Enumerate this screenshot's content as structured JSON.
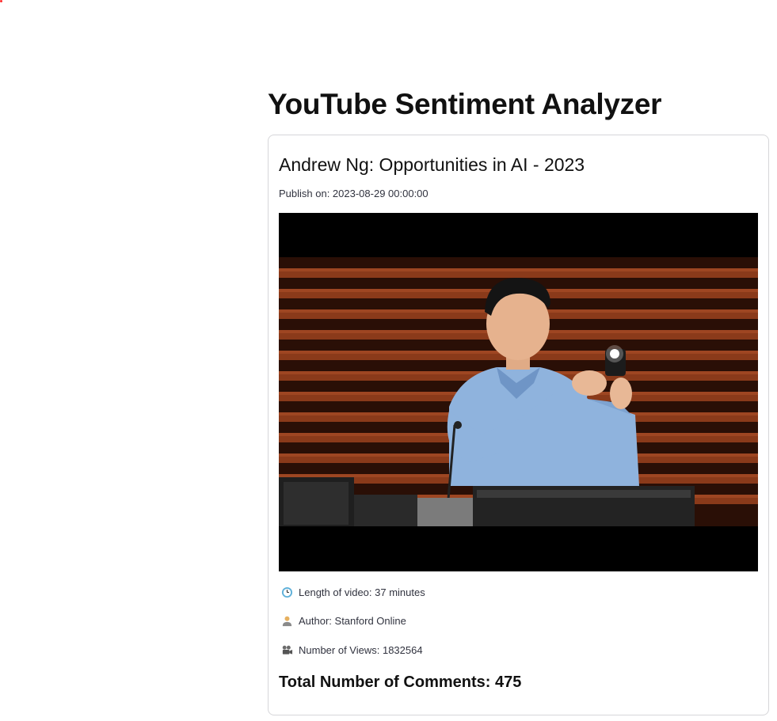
{
  "app": {
    "title": "YouTube Sentiment Analyzer"
  },
  "video": {
    "title": "Andrew Ng: Opportunities in AI - 2023",
    "publish_label": "Publish on: 2023-08-29 00:00:00",
    "thumbnail_alt": "Video thumbnail",
    "length_text": "Length of video: 37 minutes",
    "author_text": "Author: Stanford Online",
    "views_text": "Number of Views: 1832564",
    "total_comments_text": "Total Number of Comments: 475"
  },
  "icons": {
    "length": "clock-icon",
    "author": "person-icon",
    "views": "camera-icon"
  },
  "colors": {
    "accent_dot": "#ff2b2b",
    "card_border": "#d6d6d9",
    "text": "#31333f"
  }
}
